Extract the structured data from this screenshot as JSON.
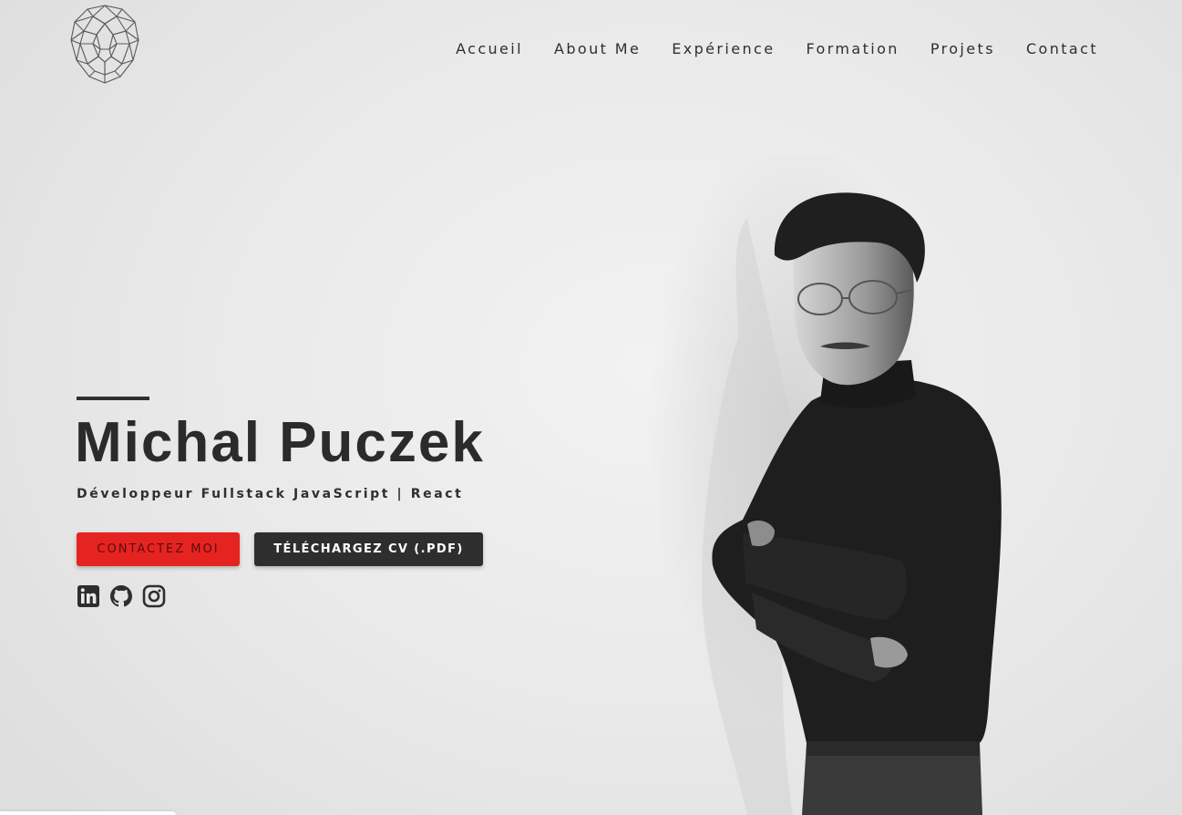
{
  "nav": {
    "items": [
      {
        "label": "Accueil"
      },
      {
        "label": "About Me"
      },
      {
        "label": "Expérience"
      },
      {
        "label": "Formation"
      },
      {
        "label": "Projets"
      },
      {
        "label": "Contact"
      }
    ]
  },
  "hero": {
    "name": "Michal Puczek",
    "subtitle": "Développeur Fullstack JavaScript | React",
    "contact_button": "CONTACTEZ MOI",
    "cv_button": "TÉLÉCHARGEZ CV (.PDF)"
  },
  "socials": [
    {
      "icon": "linkedin-icon"
    },
    {
      "icon": "github-icon"
    },
    {
      "icon": "instagram-icon"
    }
  ],
  "colors": {
    "accent": "#e52421",
    "dark": "#2e2e2e",
    "background": "#ebebeb"
  }
}
